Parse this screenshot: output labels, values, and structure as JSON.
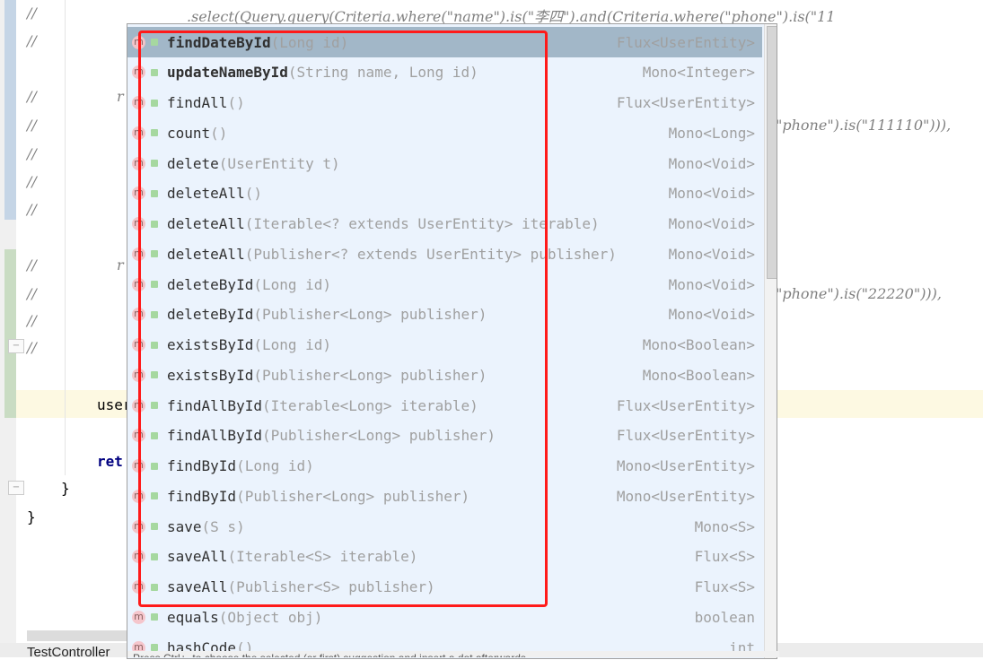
{
  "editor": {
    "comment_marker": "//",
    "line_select": ".select(Query.query(Criteria.where(\"name\").is(\"李四\").and(Criteria.where(\"phone\").is(\"11",
    "line_r1": "r",
    "line_phone1": "\"phone\").is(\"111110\"))),",
    "line_r2": "r",
    "line_phone2": "\"phone\").is(\"22220\"))),",
    "line_user": "user",
    "line_return": "ret",
    "brace_inner": "}",
    "brace_outer": "}"
  },
  "completion": {
    "method_icon": "m",
    "items": [
      {
        "name": "findDateById",
        "params": "(Long id)",
        "type": "Flux<UserEntity>",
        "selected": true,
        "bold": true
      },
      {
        "name": "updateNameById",
        "params": "(String name, Long id)",
        "type": "Mono<Integer>",
        "bold": true
      },
      {
        "name": "findAll",
        "params": "()",
        "type": "Flux<UserEntity>"
      },
      {
        "name": "count",
        "params": "()",
        "type": "Mono<Long>"
      },
      {
        "name": "delete",
        "params": "(UserEntity t)",
        "type": "Mono<Void>"
      },
      {
        "name": "deleteAll",
        "params": "()",
        "type": "Mono<Void>"
      },
      {
        "name": "deleteAll",
        "params": "(Iterable<? extends UserEntity> iterable)",
        "type": "Mono<Void>"
      },
      {
        "name": "deleteAll",
        "params": "(Publisher<? extends UserEntity> publisher)",
        "type": "Mono<Void>"
      },
      {
        "name": "deleteById",
        "params": "(Long id)",
        "type": "Mono<Void>"
      },
      {
        "name": "deleteById",
        "params": "(Publisher<Long> publisher)",
        "type": "Mono<Void>"
      },
      {
        "name": "existsById",
        "params": "(Long id)",
        "type": "Mono<Boolean>"
      },
      {
        "name": "existsById",
        "params": "(Publisher<Long> publisher)",
        "type": "Mono<Boolean>"
      },
      {
        "name": "findAllById",
        "params": "(Iterable<Long> iterable)",
        "type": "Flux<UserEntity>"
      },
      {
        "name": "findAllById",
        "params": "(Publisher<Long> publisher)",
        "type": "Flux<UserEntity>"
      },
      {
        "name": "findById",
        "params": "(Long id)",
        "type": "Mono<UserEntity>"
      },
      {
        "name": "findById",
        "params": "(Publisher<Long> publisher)",
        "type": "Mono<UserEntity>"
      },
      {
        "name": "save",
        "params": "(S s)",
        "type": "Mono<S>"
      },
      {
        "name": "saveAll",
        "params": "(Iterable<S> iterable)",
        "type": "Flux<S>"
      },
      {
        "name": "saveAll",
        "params": "(Publisher<S> publisher)",
        "type": "Flux<S>"
      },
      {
        "name": "equals",
        "params": "(Object obj)",
        "type": "boolean",
        "plain_icon": true
      },
      {
        "name": "hashCode",
        "params": "()",
        "type": "int",
        "plain_icon": true
      }
    ],
    "status_hint": "Press Ctrl+. to choose the selected (or first) suggestion and insert a dot afterwards"
  },
  "bottom": {
    "tab": "TestController"
  },
  "colors": {
    "highlight_box": "#ff1a1a",
    "selected_row": "#a2b7c8",
    "popup_bg": "#ebf3fd"
  }
}
